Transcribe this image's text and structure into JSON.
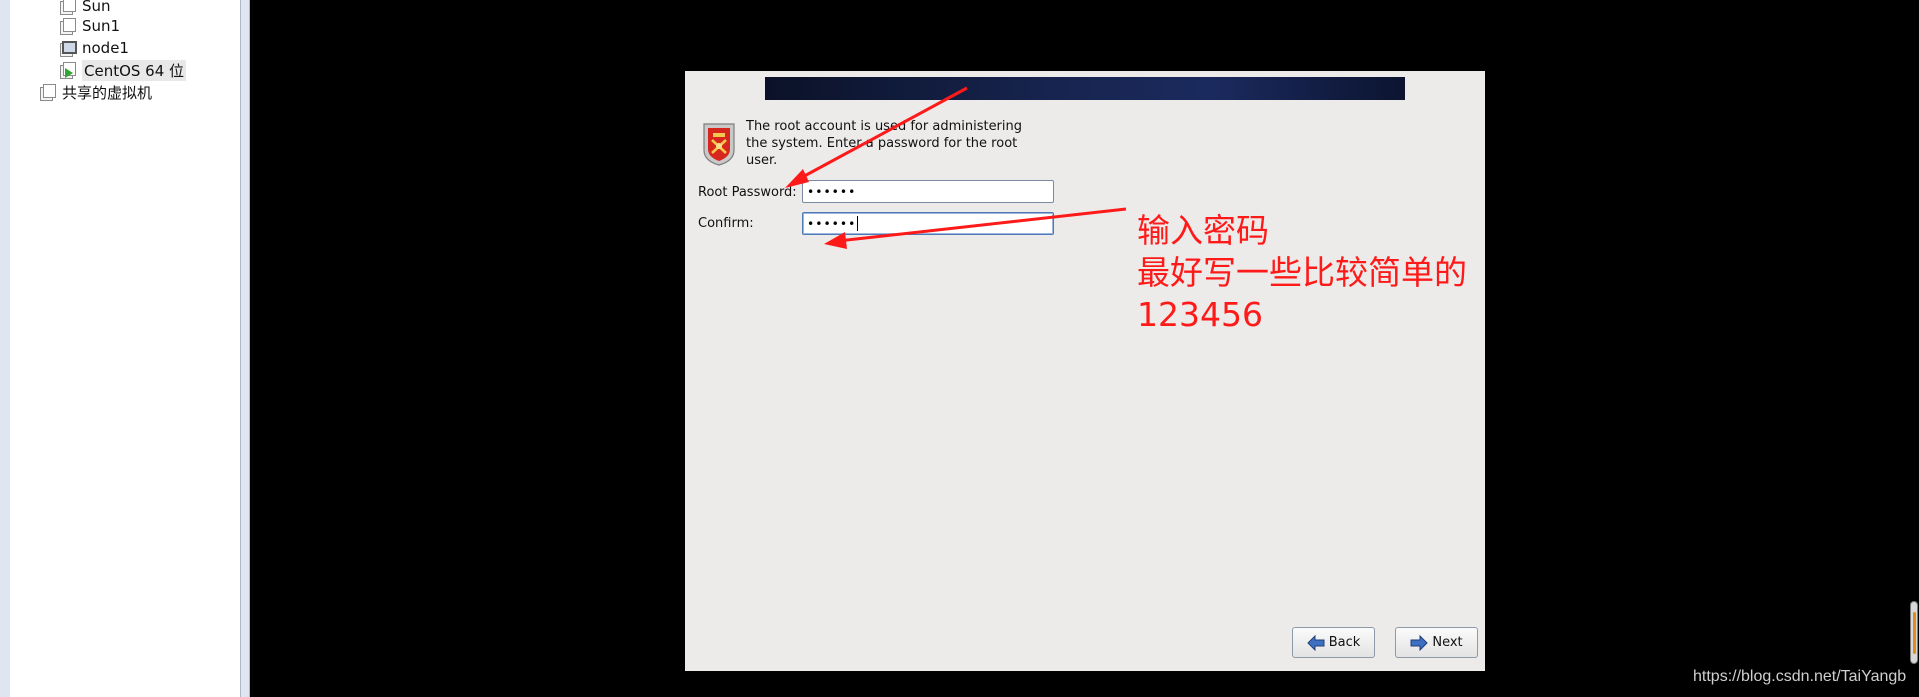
{
  "library": {
    "items": [
      {
        "label": "Sun",
        "icon": "vm-icon"
      },
      {
        "label": "Sun1",
        "icon": "vm-icon"
      },
      {
        "label": "node1",
        "icon": "vm-team-icon"
      },
      {
        "label": "CentOS 64 位",
        "icon": "vm-running-icon"
      }
    ],
    "shared_label": "共享的虚拟机"
  },
  "installer": {
    "info_text": "The root account is used for administering the system.  Enter a password for the root user.",
    "root_password_label": "Root Password:",
    "root_password_value": "••••••",
    "confirm_label": "Confirm:",
    "confirm_value": "••••••",
    "back_label": "Back",
    "next_label": "Next"
  },
  "annotations": {
    "line1": "输入密码",
    "line2": "最好写一些比较简单的",
    "line3": "123456",
    "color": "#ff1a1a"
  },
  "watermark": "https://blog.csdn.net/TaiYangb"
}
